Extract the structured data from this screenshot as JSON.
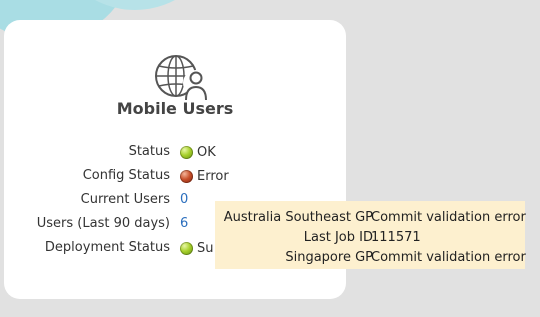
{
  "widget": {
    "title": "Mobile Users",
    "icon": "globe-user-icon",
    "rows": [
      {
        "label": "Status",
        "value": "OK",
        "status_color": "#a6cf2a"
      },
      {
        "label": "Config Status",
        "value": "Error",
        "status_color": "#c8502a"
      },
      {
        "label": "Current Users",
        "value": "0"
      },
      {
        "label": "Users (Last 90 days)",
        "value": "6"
      },
      {
        "label": "Deployment Status",
        "value": "Su",
        "status_color": "#a6cf2a"
      }
    ]
  },
  "tooltip": {
    "rows": [
      {
        "key": "Australia Southeast GP",
        "value": "Commit validation error"
      },
      {
        "key": "Last Job ID",
        "value": "111571"
      },
      {
        "key": "Singapore GP",
        "value": "Commit validation error"
      }
    ]
  },
  "colors": {
    "background": "#e1e1e1",
    "cloud": "#a9dde4",
    "link": "#2a6ebd",
    "tooltip_background": "#fdf0cf"
  }
}
